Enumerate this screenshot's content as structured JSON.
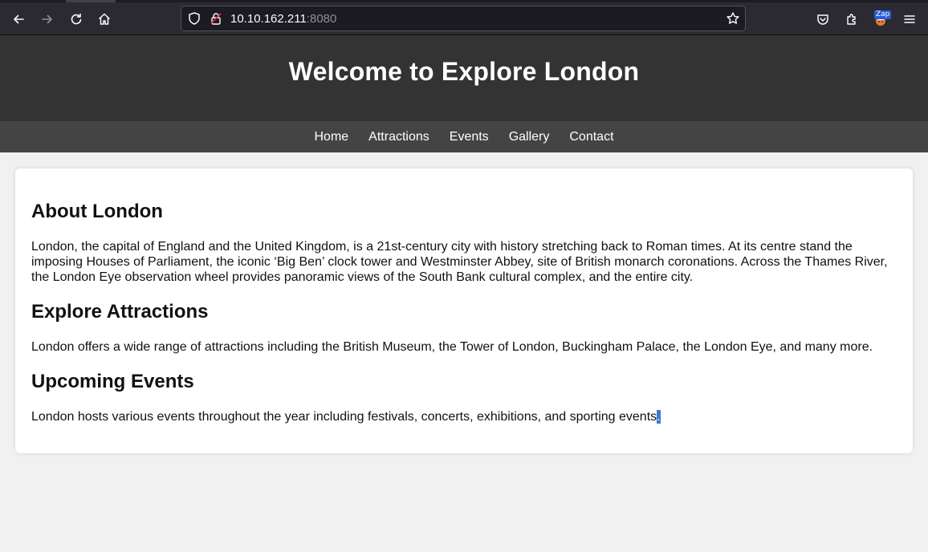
{
  "browser": {
    "url_host": "10.10.162.211",
    "url_port": ":8080",
    "zap_label": "Zap"
  },
  "site": {
    "title": "Welcome to Explore London",
    "nav": [
      "Home",
      "Attractions",
      "Events",
      "Gallery",
      "Contact"
    ]
  },
  "sections": [
    {
      "heading": "About London",
      "body": "London, the capital of England and the United Kingdom, is a 21st-century city with history stretching back to Roman times. At its centre stand the imposing Houses of Parliament, the iconic ‘Big Ben’ clock tower and Westminster Abbey, site of British monarch coronations. Across the Thames River, the London Eye observation wheel provides panoramic views of the South Bank cultural complex, and the entire city."
    },
    {
      "heading": "Explore Attractions",
      "body": "London offers a wide range of attractions including the British Museum, the Tower of London, Buckingham Palace, the London Eye, and many more."
    },
    {
      "heading": "Upcoming Events",
      "body": "London hosts various events throughout the year including festivals, concerts, exhibitions, and sporting events",
      "selected": "."
    }
  ]
}
